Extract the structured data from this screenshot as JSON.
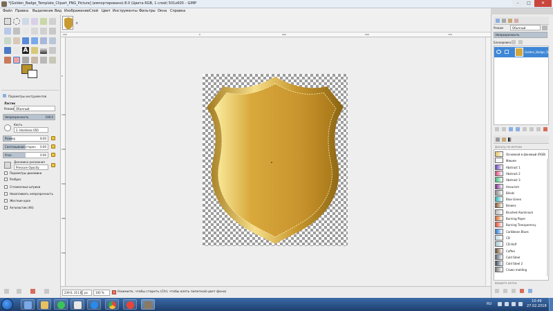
{
  "window": {
    "title": "*[Golden_Badge_Template_Clipart_PNG_Picture] (импортировано)-8.0 (Цвета RGB, 1 слой) 501x600 – GIMP"
  },
  "menu": [
    "Файл",
    "Правка",
    "Выделение",
    "Вид",
    "Изображение",
    "Слой",
    "Цвет",
    "Инструменты",
    "Фильтры",
    "Окна",
    "Справка"
  ],
  "tool_options": {
    "panel_title": "Параметры инструментов",
    "tool_name": "Ластик",
    "mode_label": "Режим",
    "mode_value": "Обычный",
    "opacity_label": "Непрозрачность",
    "opacity_value": "100.0",
    "brush_label": "Кисть",
    "brush_value": "2. Hardness 050",
    "size_label": "Размер",
    "size_value": "8.00",
    "aspect_label": "Соотношение сторон",
    "aspect_value": "0.00",
    "angle_label": "Угол",
    "angle_value": "0.00",
    "dynamics_label": "Динамика рисования",
    "dynamics_value": "Pressure Opacity",
    "dynamics_params": "Параметры динамики",
    "checkboxes": [
      "Разброс",
      "Сглаженные штрихи",
      "Накапливать непрозрачность",
      "Жесткие края",
      "Антиластик (Alt)"
    ]
  },
  "ruler": {
    "h_ticks": [
      "-250",
      "",
      "",
      "0",
      "250",
      "500",
      "750"
    ],
    "v_ticks": [
      "0",
      "100",
      "200",
      "300",
      "400",
      "500"
    ]
  },
  "status": {
    "coords": "239.0, 311.0",
    "unit": "px",
    "zoom": "100 %",
    "message": "Нажмите, чтобы стереть (Ctrl, чтобы взять пипеткой цвет фона)"
  },
  "layers": {
    "mode_label": "Режим",
    "mode_value": "Обычный",
    "opacity_label": "Непрозрачность",
    "lock_label": "Блокировка:",
    "layer_name": "Golden_Badge_Te"
  },
  "gradients": {
    "filter_label": "фильтр по меткам",
    "tag_label": "введите метки",
    "items": [
      {
        "name": "Основной в фоновый (RGB)",
        "color": "#e8c060"
      },
      {
        "name": "Фишки",
        "color": "#f0f0f0"
      },
      {
        "name": "Abstract 1",
        "color": "#6a46b8"
      },
      {
        "name": "Abstract 2",
        "color": "#d84a7a"
      },
      {
        "name": "Abstract 3",
        "color": "#3ac27a"
      },
      {
        "name": "Aneurism",
        "color": "#7a2a8a"
      },
      {
        "name": "Blinds",
        "color": "#8a8a8a"
      },
      {
        "name": "Blue Green",
        "color": "#2ab8c0"
      },
      {
        "name": "Browns",
        "color": "#8a5a2a"
      },
      {
        "name": "Brushed Aluminium",
        "color": "#b8b8b8"
      },
      {
        "name": "Burning Paper",
        "color": "#d86a2a"
      },
      {
        "name": "Burning Transparency",
        "color": "#e84a2a"
      },
      {
        "name": "Caribbean Blues",
        "color": "#2a78d8"
      },
      {
        "name": "CD",
        "color": "#c0d8e0"
      },
      {
        "name": "CD Half",
        "color": "#a0c8d0"
      },
      {
        "name": "Coffee",
        "color": "#6a4a2a"
      },
      {
        "name": "Cold Steel",
        "color": "#5a6a7a"
      },
      {
        "name": "Cold Steel 2",
        "color": "#3a4a5a"
      },
      {
        "name": "Crown molding",
        "color": "#7a7a7a"
      }
    ]
  },
  "taskbar": {
    "lang": "RU",
    "time": "10:49",
    "date": "27.02.2018"
  },
  "colors": {
    "gold": "#b8922a",
    "selection": "#3e87d6",
    "taskbar": "#1e3f6d"
  }
}
